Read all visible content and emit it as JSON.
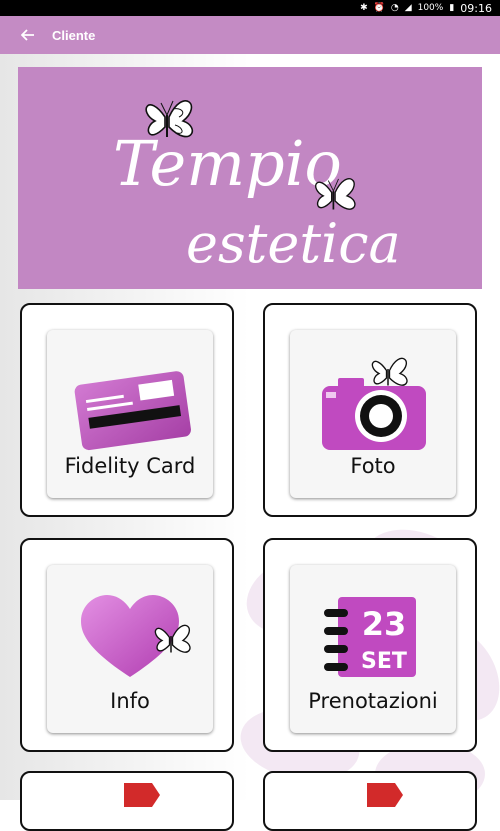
{
  "status_bar": {
    "battery": "100%",
    "time": "09:16",
    "icons": [
      "bluetooth-icon",
      "alarm-icon",
      "wifi-icon",
      "cell-signal-icon",
      "battery-icon"
    ]
  },
  "app_bar": {
    "title": "Cliente",
    "back_icon": "arrow-back-icon"
  },
  "banner": {
    "logo_text_line1": "Tempio",
    "logo_text_line2": "estetica",
    "background_color": "#c287c3"
  },
  "menu": {
    "items": [
      {
        "label": "Fidelity Card",
        "icon": "fidelity-card-icon"
      },
      {
        "label": "Foto",
        "icon": "camera-icon"
      },
      {
        "label": "Info",
        "icon": "heart-icon"
      },
      {
        "label": "Prenotazioni",
        "icon": "calendar-icon",
        "calendar_day": "23",
        "calendar_month": "SET"
      }
    ]
  },
  "colors": {
    "accent": "#c48bc4",
    "icon_magenta": "#c04ac0",
    "tile_border": "#111111"
  }
}
